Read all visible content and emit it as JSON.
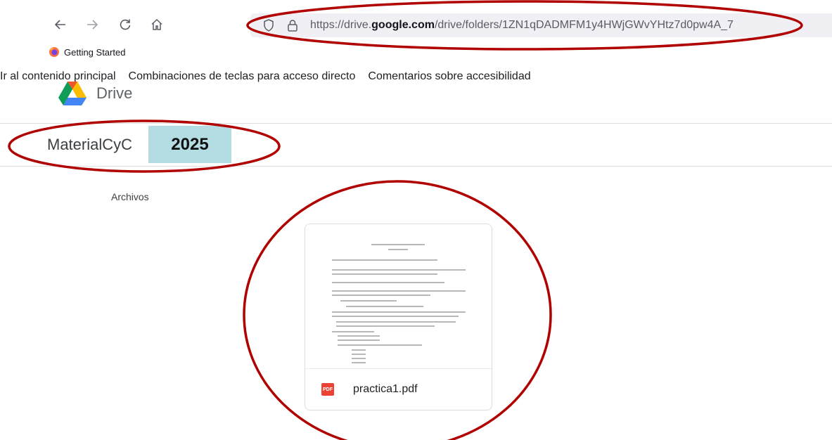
{
  "browser": {
    "url_prefix": "https://drive.",
    "url_domain": "google.com",
    "url_path": "/drive/folders/1ZN1qDADMFM1y4HWjGWvYHtz7d0pw4A_7",
    "bookmarks": [
      {
        "label": "Getting Started",
        "icon": "firefox-icon"
      }
    ],
    "nav_icons": [
      "back-arrow-icon",
      "forward-arrow-icon",
      "reload-icon",
      "home-icon"
    ],
    "urlbar_icons": [
      "shield-icon",
      "lock-icon"
    ]
  },
  "drive": {
    "skip_links": [
      "Ir al contenido principal",
      "Combinaciones de teclas para acceso directo",
      "Comentarios sobre accesibilidad"
    ],
    "logo_text": "Drive",
    "folder_title": "MaterialCyC",
    "year_badge": "2025",
    "section_label": "Archivos",
    "files": [
      {
        "name": "practica1.pdf",
        "type_icon": "pdf-icon",
        "icon_label": "PDF"
      }
    ]
  },
  "annotation_color": "#b00000"
}
